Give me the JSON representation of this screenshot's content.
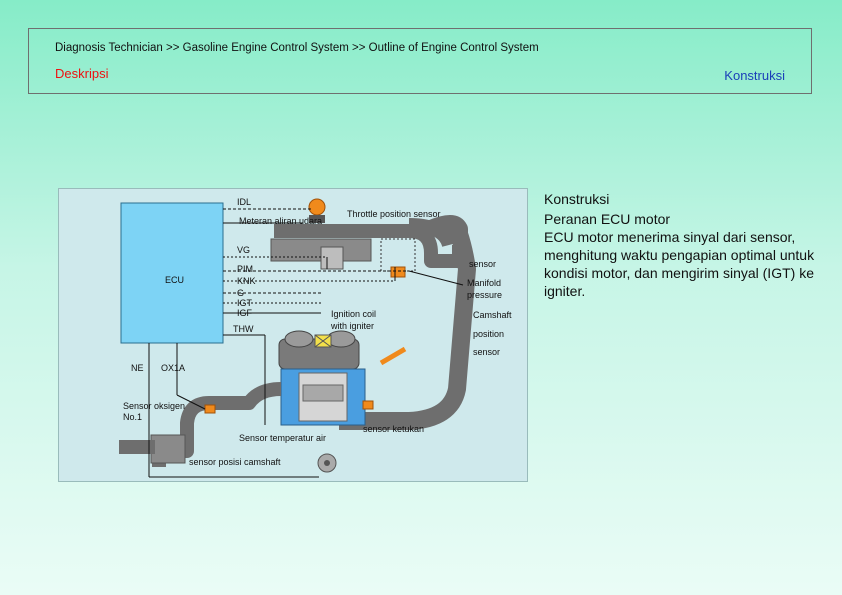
{
  "header": {
    "breadcrumb": "Diagnosis Technician >> Gasoline Engine Control System >> Outline of Engine Control System",
    "tab_deskripsi": "Deskripsi",
    "tab_konstruksi": "Konstruksi"
  },
  "diagram": {
    "labels": {
      "idl": "IDL",
      "meteran": "Meteran aliran udara",
      "throttle": "Throttle position sensor",
      "vg": "VG",
      "ecu": "ECU",
      "pim": "PIM",
      "knk": "KNK",
      "g": "G",
      "igt": "IGT",
      "igf": "IGF",
      "thw": "THW",
      "ignition": "Ignition coil\nwith igniter",
      "sensor": "sensor",
      "manifold": "Manifold\npressure",
      "camshaft": "Camshaft",
      "position": "position",
      "sensor2": "sensor",
      "ne": "NE",
      "ox1a": "OX1A",
      "oksigen": "Sensor oksigen\nNo.1",
      "temperatur": "Sensor temperatur air",
      "ketukan": "sensor ketukan",
      "camshaft_posisi": "sensor posisi camshaft"
    }
  },
  "side": {
    "title": "Konstruksi",
    "subtitle": "Peranan ECU motor",
    "body": "ECU motor menerima sinyal dari sensor, menghitung waktu pengapian optimal untuk kondisi motor, dan mengirim sinyal (IGT) ke igniter."
  }
}
